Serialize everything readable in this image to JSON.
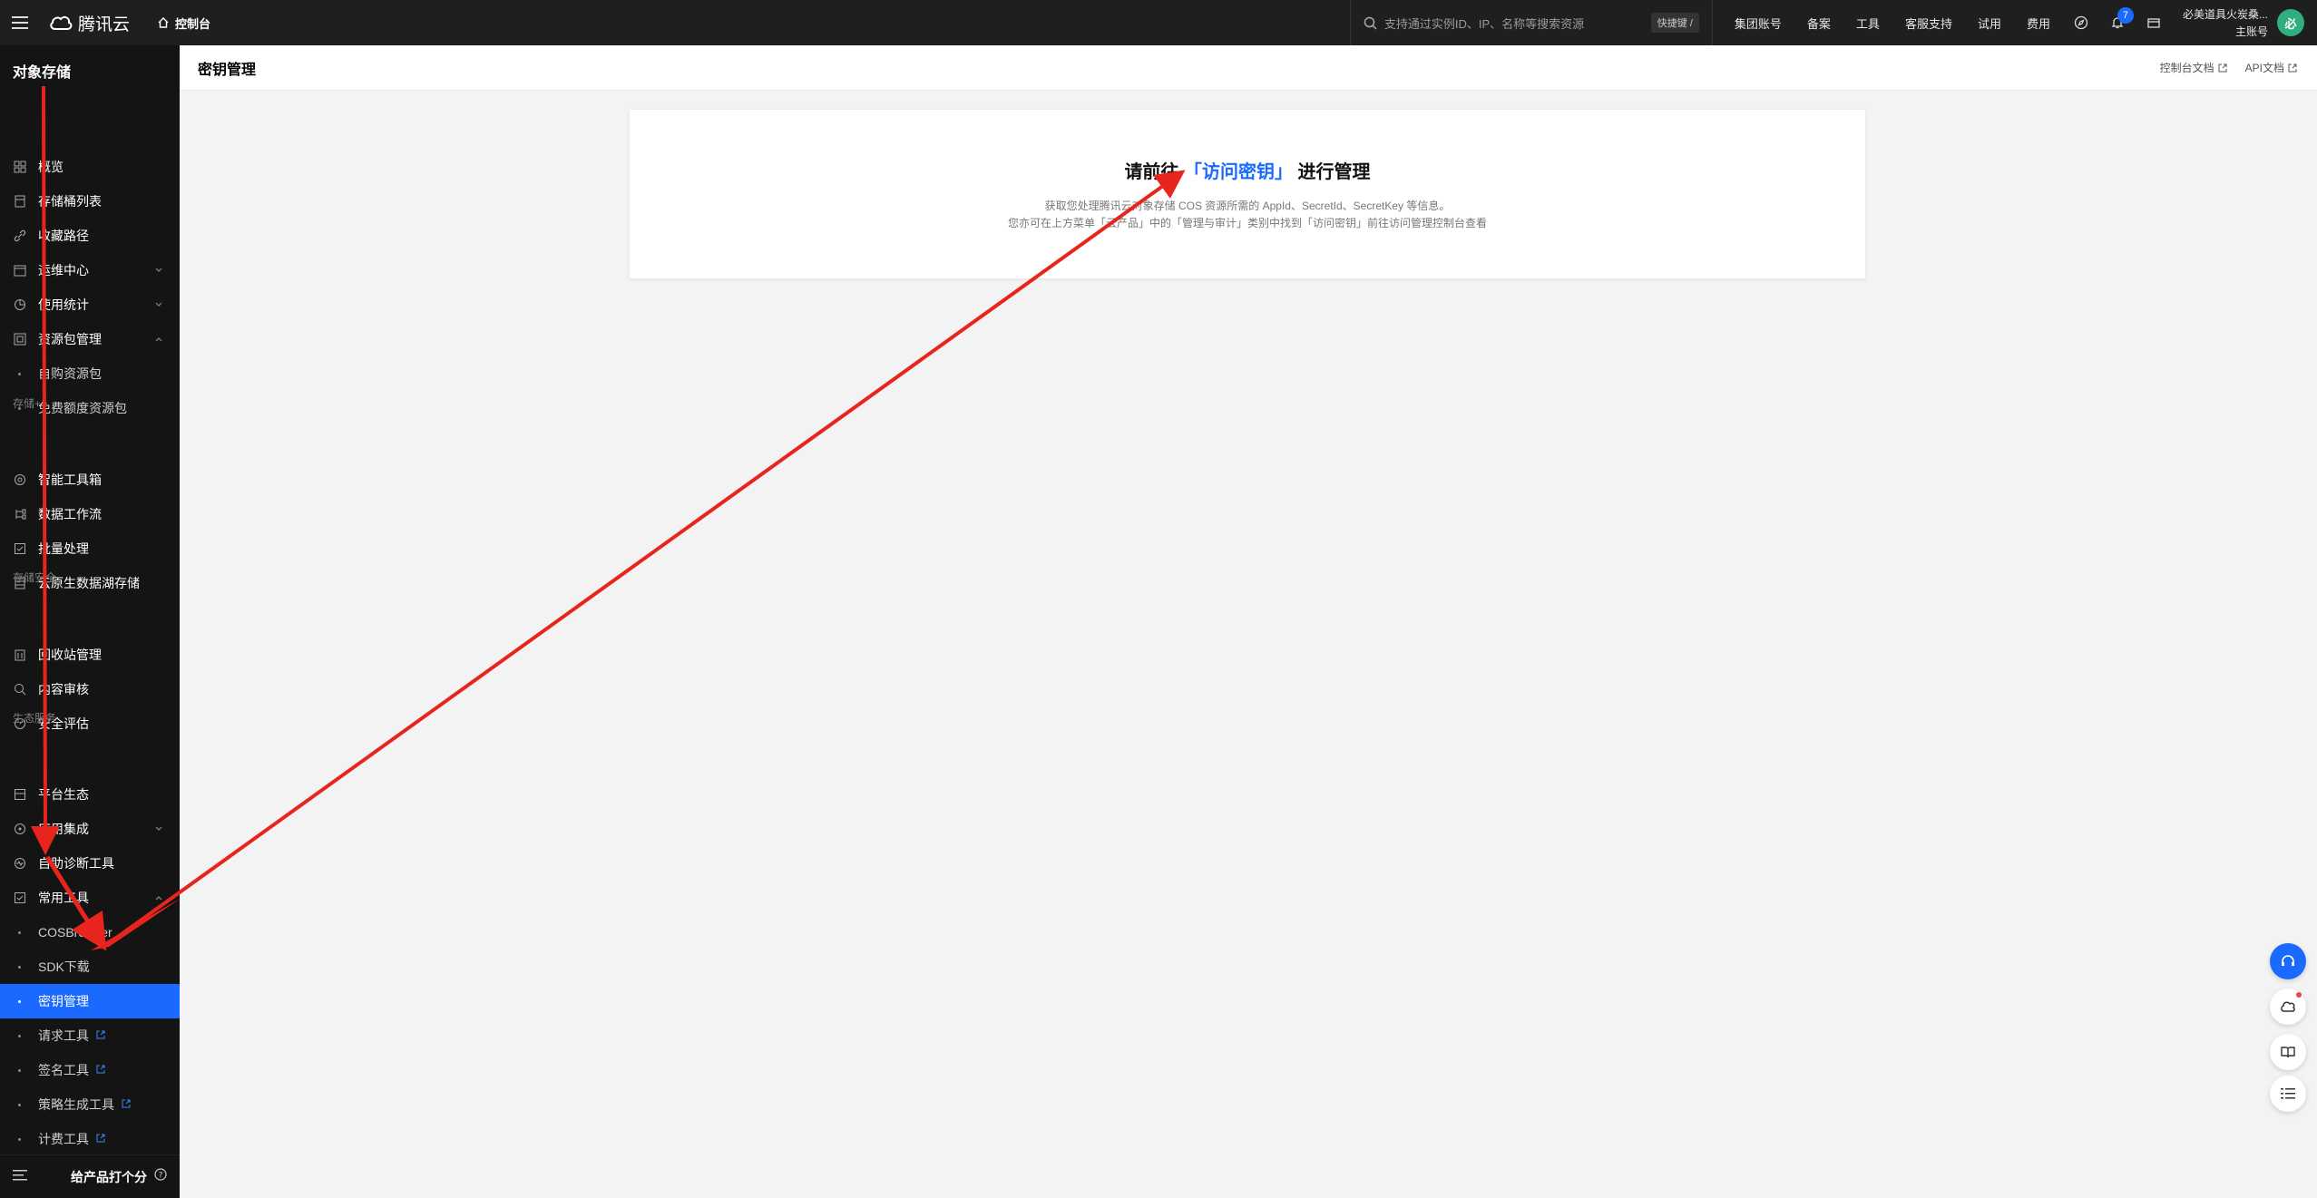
{
  "topbar": {
    "brand": "腾讯云",
    "console": "控制台",
    "search_placeholder": "支持通过实例ID、IP、名称等搜索资源",
    "shortcut": "快捷键 /",
    "nav": [
      "集团账号",
      "备案",
      "工具",
      "客服支持",
      "试用",
      "费用"
    ],
    "notification_count": "7",
    "user_name": "必美道具火炭桑...",
    "user_role": "主账号",
    "avatar_text": "必"
  },
  "sidebar": {
    "title": "对象存储",
    "items": [
      {
        "label": "概览",
        "icon": "grid-icon"
      },
      {
        "label": "存储桶列表",
        "icon": "bucket-icon"
      },
      {
        "label": "收藏路径",
        "icon": "link-icon"
      },
      {
        "label": "运维中心",
        "icon": "calendar-icon"
      },
      {
        "label": "使用统计",
        "icon": "pie-icon"
      },
      {
        "label": "资源包管理",
        "icon": "package-icon"
      }
    ],
    "subitems_package": [
      "自购资源包",
      "免费额度资源包"
    ],
    "section_storage_plus": "存储+",
    "items_storage_plus": [
      "智能工具箱",
      "数据工作流",
      "批量处理",
      "云原生数据湖存储"
    ],
    "section_security": "存储安全",
    "items_security": [
      "回收站管理",
      "内容审核",
      "安全评估"
    ],
    "section_ecosystem": "生态服务",
    "items_ecosystem": [
      "平台生态",
      "应用集成",
      "自助诊断工具",
      "常用工具"
    ],
    "subitems_tools": [
      "COSBrowser",
      "SDK下载",
      "密钥管理",
      "请求工具",
      "签名工具",
      "策略生成工具",
      "计费工具"
    ],
    "footer_rate": "给产品打个分"
  },
  "header": {
    "title": "密钥管理",
    "link_console_docs": "控制台文档",
    "link_api_docs": "API文档"
  },
  "card": {
    "heading_prefix": "请前往 ",
    "heading_link": "「访问密钥」",
    "heading_suffix": " 进行管理",
    "desc_line1": "获取您处理腾讯云对象存储 COS 资源所需的 AppId、SecretId、SecretKey 等信息。",
    "desc_line2": "您亦可在上方菜单「云产品」中的「管理与审计」类别中找到「访问密钥」前往访问管理控制台查看"
  },
  "colors": {
    "accent": "#1b6aff",
    "annotation": "#e8251c"
  }
}
